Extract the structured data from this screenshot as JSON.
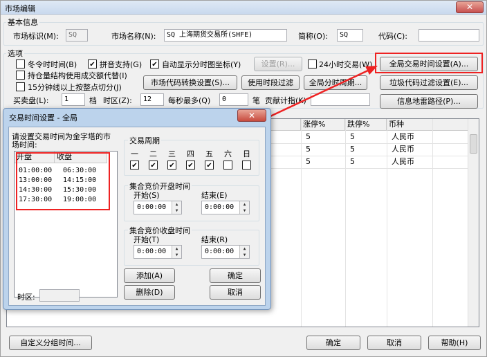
{
  "window": {
    "title": "市场编辑",
    "close": "✕"
  },
  "basic": {
    "group_title": "基本信息",
    "market_id_label": "市场标识(M):",
    "market_id_value": "SQ",
    "market_name_label": "市场名称(N):",
    "market_name_value": "SQ 上海期货交易所(SHFE)",
    "short_label": "简称(O):",
    "short_value": "SQ",
    "code_label": "代码(C):",
    "code_value": ""
  },
  "options": {
    "group_title": "选项",
    "winter_time": "冬令时时间(B)",
    "pinyin": "拼音支持(G)",
    "auto_time_axis": "自动显示分时图坐标(Y)",
    "settings_btn": "设置(R)...",
    "h24": "24小时交易(W)",
    "global_time_btn": "全局交易时间设置(A)...",
    "position_struct": "持仓量结构使用成交额代替(I)",
    "code_convert_btn": "市场代码转换设置(S)...",
    "use_period_filter_btn": "使用时段过滤",
    "global_period_btn": "全局分时周期...",
    "junk_filter_btn": "垃圾代码过滤设置(E)...",
    "min15": "15分钟线以上按整点切分(J)",
    "buysell_label": "买卖盘(L):",
    "buysell_value": "1",
    "ticks_label": "档",
    "tz_label": "时区(Z):",
    "tz_value": "12",
    "min_sec_label": "每秒最多(Q)",
    "min_sec_value": "0",
    "pen_label": "笔",
    "contrib_label": "贡献计指(K)",
    "contrib_value": "",
    "info_path_btn": "信息地雷路径(P)..."
  },
  "grid": {
    "headers": [
      "别",
      "涨停%",
      "跌停%",
      "币种"
    ],
    "rows": [
      [
        "",
        "5",
        "5",
        "人民币"
      ],
      [
        "",
        "5",
        "5",
        "人民币"
      ],
      [
        "",
        "5",
        "5",
        "人民币"
      ]
    ]
  },
  "footer": {
    "custom_group_btn": "自定义分组时间...",
    "ok_btn": "确定",
    "cancel_btn": "取消",
    "help_btn": "帮助(H)"
  },
  "dialog": {
    "title": "交易时间设置 - 全局",
    "close": "✕",
    "note": "请设置交易时间为金字塔的市场时间:",
    "list_headers": [
      "开盘",
      "收盘"
    ],
    "sessions": [
      [
        "01:00:00",
        "06:30:00"
      ],
      [
        "13:00:00",
        "14:15:00"
      ],
      [
        "14:30:00",
        "15:30:00"
      ],
      [
        "17:30:00",
        "19:00:00"
      ]
    ],
    "timezone_label": "时区:",
    "timezone_value": "",
    "week_group": "交易周期",
    "weekdays": [
      "一",
      "二",
      "三",
      "四",
      "五",
      "六",
      "日"
    ],
    "open_group": "集合竞价开盘时间",
    "close_group": "集合竞价收盘时间",
    "start_s": "开始(S)",
    "end_e": "结束(E)",
    "start_t": "开始(T)",
    "end_r": "结束(R)",
    "time_zero": "0:00:00",
    "add_btn": "添加(A)",
    "delete_btn": "删除(D)",
    "ok_btn": "确定",
    "cancel_btn": "取消"
  }
}
